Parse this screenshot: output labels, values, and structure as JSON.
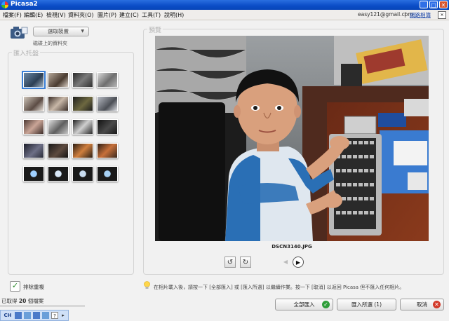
{
  "window": {
    "title": "Picasa2"
  },
  "menu": [
    "檔案(F)",
    "編輯(E)",
    "檢視(V)",
    "資料夾(O)",
    "圖片(P)",
    "建立(C)",
    "工具(T)",
    "說明(H)"
  ],
  "account": {
    "email": "easy121@gmail.com",
    "sep": "|",
    "link": "網路相簿"
  },
  "source": {
    "button_label": "選取裝置",
    "caption": "磁碟上的資料夾"
  },
  "tray": {
    "label": "匯入托盤"
  },
  "preview": {
    "label": "預覽",
    "filename": "DSCN3140.JPG"
  },
  "exclude": {
    "label": "排除重複"
  },
  "status": {
    "prefix": "已取得",
    "count": "20",
    "suffix": "個檔案"
  },
  "info": {
    "text": "在相片載入後，請按一下 [全部匯入] 或 [匯入所選] 以繼續作業。按一下 [取消] 以返回 Picasa 但不匯入任何相片。"
  },
  "actions": {
    "import_all": "全部匯入",
    "import_selected": "匯入所選 (1)",
    "cancel": "取消"
  },
  "taskbar": {
    "lang": "CH"
  }
}
